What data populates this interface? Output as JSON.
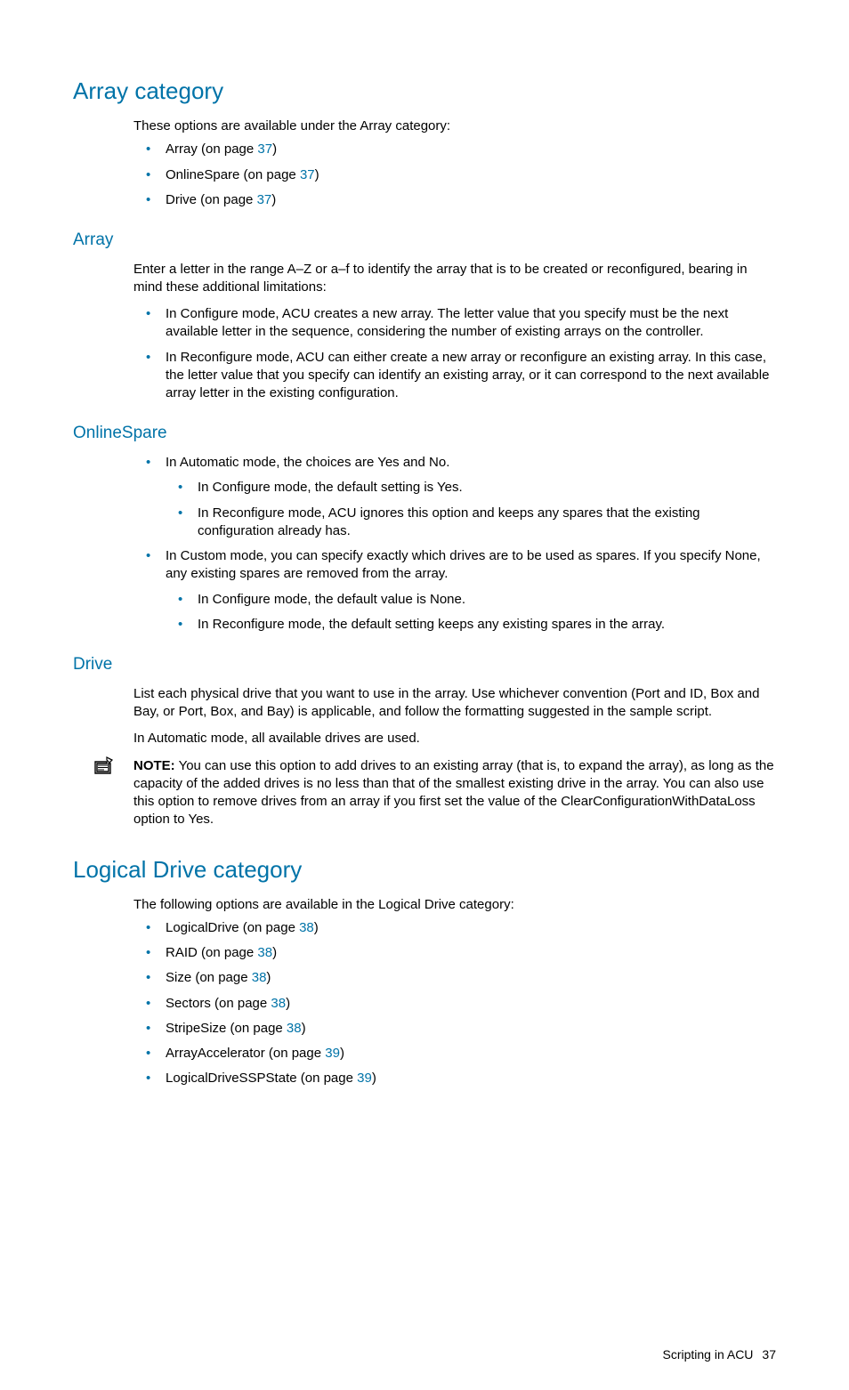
{
  "sections": {
    "array_category": {
      "title": "Array category",
      "intro": "These options are available under the Array category:",
      "items": [
        {
          "label": "Array (on page ",
          "page": "37",
          "suffix": ")"
        },
        {
          "label": "OnlineSpare (on page ",
          "page": "37",
          "suffix": ")"
        },
        {
          "label": "Drive (on page ",
          "page": "37",
          "suffix": ")"
        }
      ]
    },
    "array": {
      "title": "Array",
      "intro": "Enter a letter in the range A–Z or a–f to identify the array that is to be created or reconfigured, bearing in mind these additional limitations:",
      "items": [
        "In Configure mode, ACU creates a new array. The letter value that you specify must be the next available letter in the sequence, considering the number of existing arrays on the controller.",
        "In Reconfigure mode, ACU can either create a new array or reconfigure an existing array. In this case, the letter value that you specify can identify an existing array, or it can correspond to the next available array letter in the existing configuration."
      ]
    },
    "onlinespare": {
      "title": "OnlineSpare",
      "items": [
        {
          "text": "In Automatic mode, the choices are Yes and No.",
          "sub": [
            "In Configure mode, the default setting is Yes.",
            "In Reconfigure mode, ACU ignores this option and keeps any spares that the existing configuration already has."
          ]
        },
        {
          "text": "In Custom mode, you can specify exactly which drives are to be used as spares. If you specify None, any existing spares are removed from the array.",
          "sub": [
            "In Configure mode, the default value is None.",
            "In Reconfigure mode, the default setting keeps any existing spares in the array."
          ]
        }
      ]
    },
    "drive": {
      "title": "Drive",
      "para1": "List each physical drive that you want to use in the array. Use whichever convention (Port and ID, Box and Bay, or Port, Box, and Bay) is applicable, and follow the formatting suggested in the sample script.",
      "para2": "In Automatic mode, all available drives are used.",
      "note_label": "NOTE:",
      "note_text": "  You can use this option to add drives to an existing array (that is, to expand the array), as long as the capacity of the added drives is no less than that of the smallest existing drive in the array. You can also use this option to remove drives from an array if you first set the value of the ClearConfigurationWithDataLoss option to Yes."
    },
    "logical_drive_category": {
      "title": "Logical Drive category",
      "intro": "The following options are available in the Logical Drive category:",
      "items": [
        {
          "label": "LogicalDrive (on page ",
          "page": "38",
          "suffix": ")"
        },
        {
          "label": "RAID (on page ",
          "page": "38",
          "suffix": ")"
        },
        {
          "label": "Size (on page ",
          "page": "38",
          "suffix": ")"
        },
        {
          "label": "Sectors (on page ",
          "page": "38",
          "suffix": ")"
        },
        {
          "label": "StripeSize (on page ",
          "page": "38",
          "suffix": ")"
        },
        {
          "label": "ArrayAccelerator (on page ",
          "page": "39",
          "suffix": ")"
        },
        {
          "label": "LogicalDriveSSPState (on page ",
          "page": "39",
          "suffix": ")"
        }
      ]
    }
  },
  "footer": {
    "text": "Scripting in ACU",
    "page": "37"
  }
}
